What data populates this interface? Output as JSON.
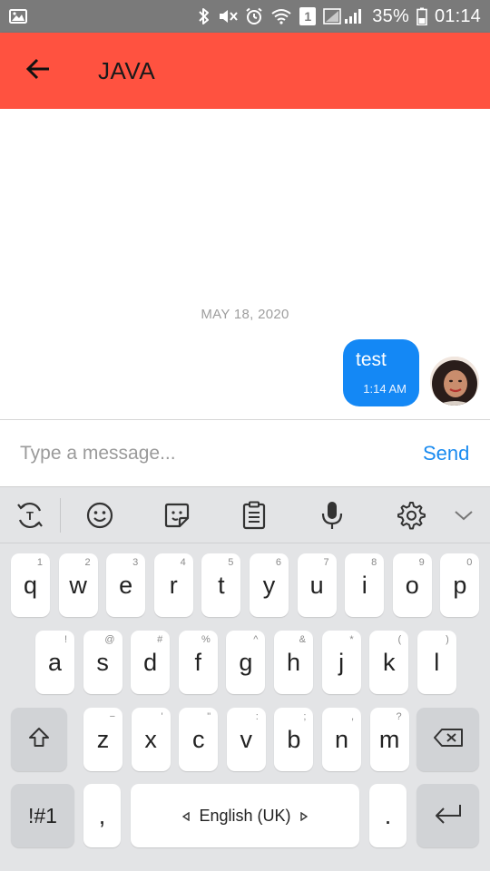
{
  "status_bar": {
    "battery": "35%",
    "time": "01:14",
    "sim_slot": "1",
    "icons": [
      "gallery-icon",
      "bluetooth-icon",
      "mute-icon",
      "alarm-icon",
      "wifi-icon",
      "sim-icon",
      "signal-icon",
      "battery-icon"
    ]
  },
  "app_bar": {
    "title": "JAVA",
    "back_icon": "arrow-left-icon",
    "color": "#ff5240"
  },
  "chat": {
    "date_separator": "MAY 18, 2020",
    "messages": [
      {
        "text": "test",
        "time": "1:14 AM",
        "outgoing": true,
        "bubble_color": "#1488f5"
      }
    ]
  },
  "composer": {
    "placeholder": "Type a message...",
    "value": "",
    "send_label": "Send",
    "send_color": "#1a8bf0"
  },
  "keyboard": {
    "toolbar_icons": [
      "translate-icon",
      "emoji-icon",
      "sticker-icon",
      "clipboard-icon",
      "microphone-icon",
      "gear-icon",
      "chevron-down-icon"
    ],
    "row1": [
      {
        "key": "q",
        "hint": "1"
      },
      {
        "key": "w",
        "hint": "2"
      },
      {
        "key": "e",
        "hint": "3"
      },
      {
        "key": "r",
        "hint": "4"
      },
      {
        "key": "t",
        "hint": "5"
      },
      {
        "key": "y",
        "hint": "6"
      },
      {
        "key": "u",
        "hint": "7"
      },
      {
        "key": "i",
        "hint": "8"
      },
      {
        "key": "o",
        "hint": "9"
      },
      {
        "key": "p",
        "hint": "0"
      }
    ],
    "row2": [
      {
        "key": "a",
        "hint": "!"
      },
      {
        "key": "s",
        "hint": "@"
      },
      {
        "key": "d",
        "hint": "#"
      },
      {
        "key": "f",
        "hint": "%"
      },
      {
        "key": "g",
        "hint": "^"
      },
      {
        "key": "h",
        "hint": "&"
      },
      {
        "key": "j",
        "hint": "*"
      },
      {
        "key": "k",
        "hint": "("
      },
      {
        "key": "l",
        "hint": ")"
      }
    ],
    "row3": [
      {
        "key": "z",
        "hint": "−"
      },
      {
        "key": "x",
        "hint": "'"
      },
      {
        "key": "c",
        "hint": "\""
      },
      {
        "key": "v",
        "hint": ":"
      },
      {
        "key": "b",
        "hint": ";"
      },
      {
        "key": "n",
        "hint": ","
      },
      {
        "key": "m",
        "hint": "?"
      }
    ],
    "symbols_label": "!#1",
    "comma_label": ",",
    "space_label": "English (UK)",
    "period_label": "."
  }
}
